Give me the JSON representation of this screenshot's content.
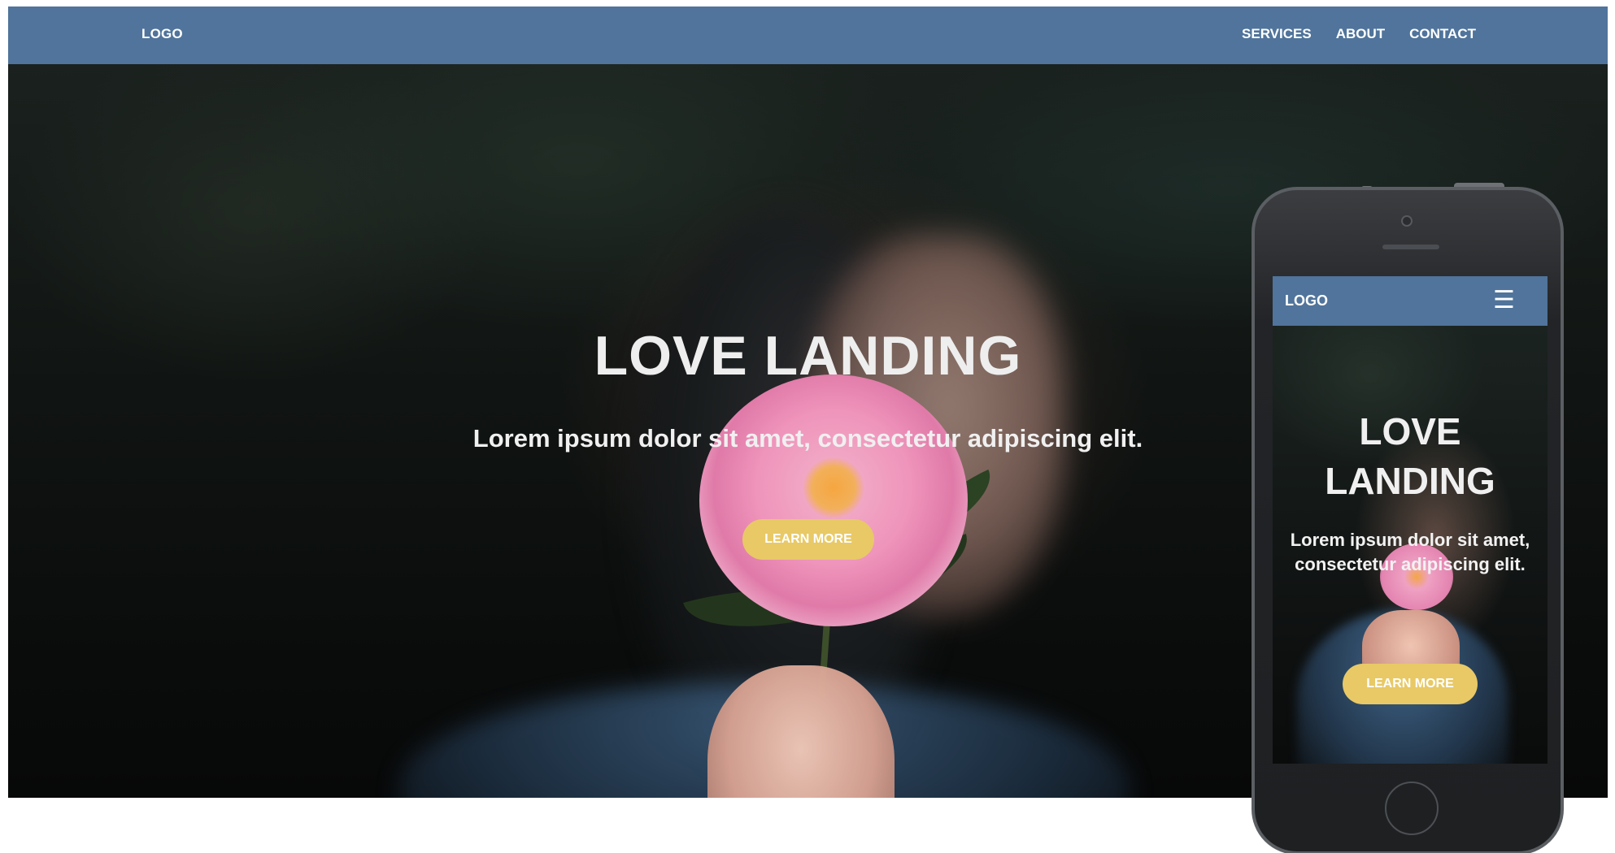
{
  "desktop": {
    "navbar": {
      "logo": "LOGO",
      "links": [
        "SERVICES",
        "ABOUT",
        "CONTACT"
      ]
    },
    "hero": {
      "title": "LOVE LANDING",
      "subtitle": "Lorem ipsum dolor sit amet, consectetur adipiscing elit.",
      "cta_label": "LEARN MORE"
    }
  },
  "mobile": {
    "navbar": {
      "logo": "LOGO",
      "menu_icon": "☰"
    },
    "hero": {
      "title_line1": "LOVE",
      "title_line2": "LANDING",
      "subtitle": "Lorem ipsum dolor sit amet, consectetur adipiscing elit.",
      "cta_label": "LEARN MORE"
    }
  },
  "colors": {
    "navbar": "#50749b",
    "cta": "#e8c966"
  }
}
